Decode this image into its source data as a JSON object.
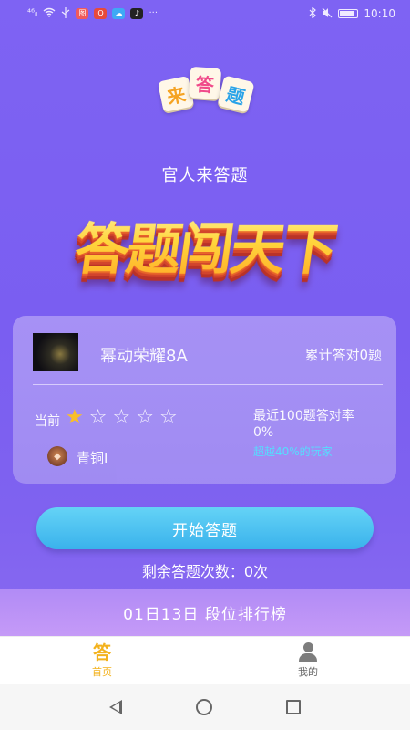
{
  "status_bar": {
    "signal": "⁴⁶ᵢₗ",
    "time": "10:10",
    "more": "···"
  },
  "logo": {
    "tiles": [
      "来",
      "答",
      "题"
    ]
  },
  "subtitle": "官人来答题",
  "hero_title": "答题闯天下",
  "profile": {
    "username": "幂动荣耀8A",
    "total_correct": "累计答对0题",
    "current_label": "当前",
    "stars_filled": 1,
    "stars_total": 5,
    "rate_label": "最近100题答对率",
    "rate_value": "0%",
    "rate_beat": "超越40%的玩家",
    "rank_name": "青铜Ⅰ"
  },
  "start_button": "开始答题",
  "remaining": "剩余答题次数：0次",
  "rank_bar": "01日13日 段位排行榜",
  "tabs": {
    "home_icon": "答",
    "home_label": "首页",
    "mine_label": "我的"
  },
  "colors": {
    "background": "#7a5cf0",
    "star_filled": "#ffc31f",
    "accent_blue": "#3ab2ec",
    "tab_active": "#f3b21d",
    "beat_text": "#54e3ff"
  }
}
